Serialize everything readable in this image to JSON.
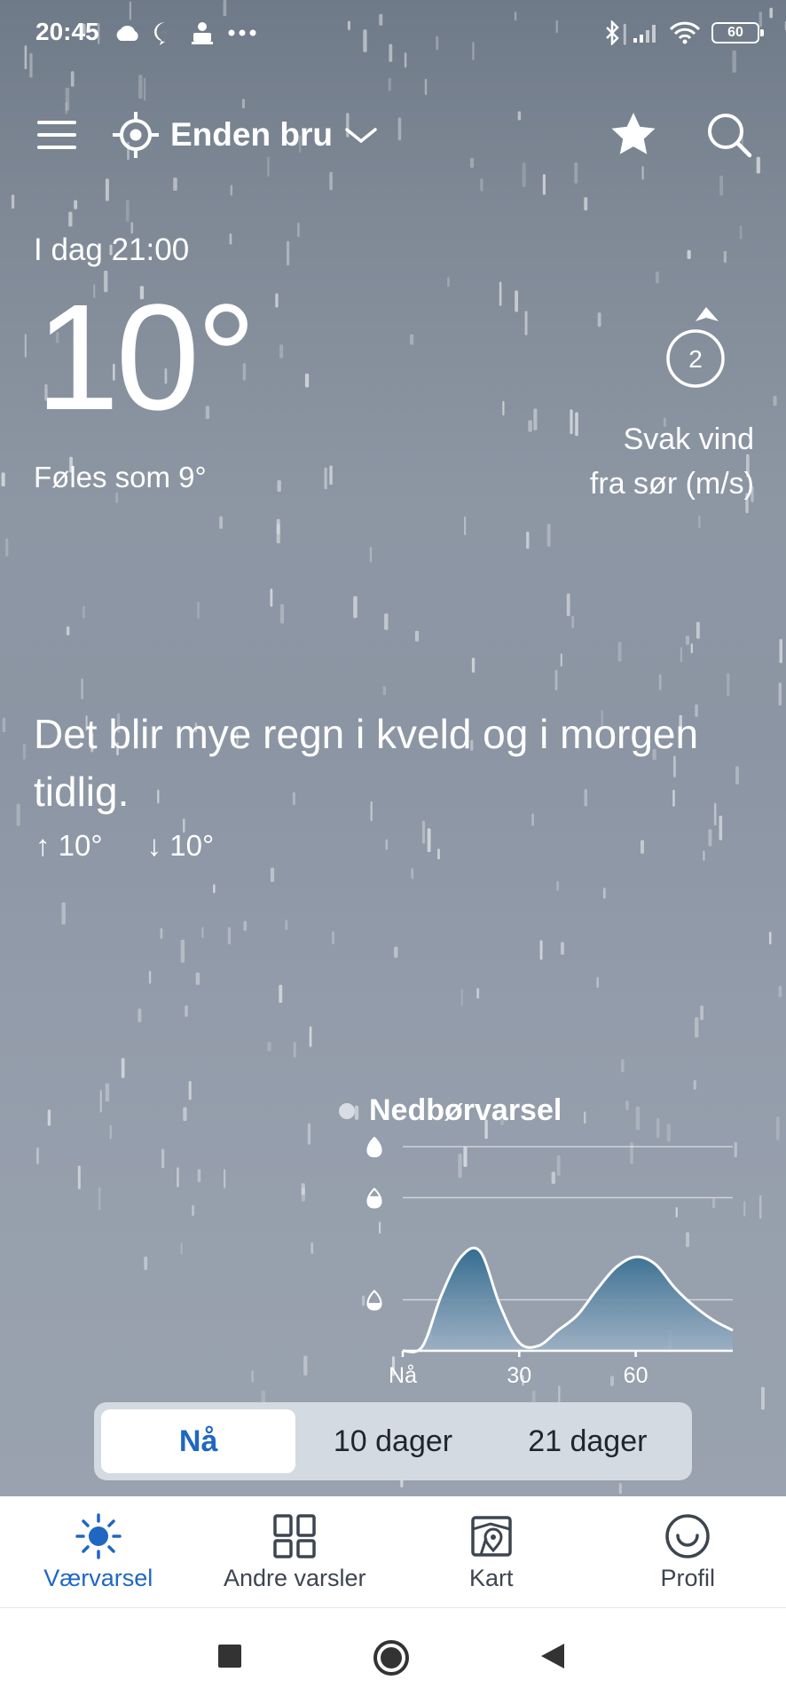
{
  "status_bar": {
    "time": "20:45",
    "battery": "60",
    "left_icons": [
      "cloud-icon",
      "messenger-icon",
      "reader-icon",
      "more-dots-icon"
    ],
    "right_icons": [
      "bluetooth-icon",
      "signal-icon",
      "wifi-icon",
      "battery-icon"
    ]
  },
  "header": {
    "location": "Enden bru"
  },
  "current": {
    "time_label": "I dag 21:00",
    "temperature": "10°",
    "feels_like": "Føles som 9°",
    "wind_speed": "2",
    "wind_line1": "Svak vind",
    "wind_line2": "fra sør (m/s)"
  },
  "forecast": {
    "summary": "Det blir mye regn i kveld og i morgen tidlig.",
    "high": "10°",
    "low": "10°"
  },
  "precipitation": {
    "title": "Nedbørvarsel"
  },
  "chart_data": {
    "type": "area",
    "title": "Nedbørvarsel",
    "x": [
      0,
      5,
      10,
      15,
      20,
      25,
      30,
      35,
      40,
      45,
      50,
      55,
      60,
      65,
      70,
      75,
      80,
      85
    ],
    "y": [
      0.0,
      0.04,
      0.55,
      0.92,
      0.97,
      0.45,
      0.08,
      0.05,
      0.2,
      0.35,
      0.6,
      0.82,
      0.92,
      0.85,
      0.62,
      0.44,
      0.3,
      0.2
    ],
    "xticks": [
      "Nå",
      "30",
      "60"
    ],
    "xtick_values": [
      0,
      30,
      60
    ],
    "y_levels": [
      "light",
      "moderate",
      "heavy"
    ],
    "ylim": [
      0,
      2
    ],
    "grid": true,
    "colors": {
      "fill_top": "#2f6a8e",
      "fill_bottom": "#9eb2c6",
      "line": "#ffffff"
    }
  },
  "segments": [
    {
      "label": "Nå",
      "active": true
    },
    {
      "label": "10 dager",
      "active": false
    },
    {
      "label": "21 dager",
      "active": false
    }
  ],
  "bottom_nav": [
    {
      "label": "Værvarsel",
      "icon": "sun-icon",
      "active": true
    },
    {
      "label": "Andre varsler",
      "icon": "grid-icon",
      "active": false
    },
    {
      "label": "Kart",
      "icon": "map-icon",
      "active": false
    },
    {
      "label": "Profil",
      "icon": "smiley-icon",
      "active": false
    }
  ],
  "colors": {
    "accent": "#1f67c2",
    "text_on_sky": "#ffffff"
  }
}
